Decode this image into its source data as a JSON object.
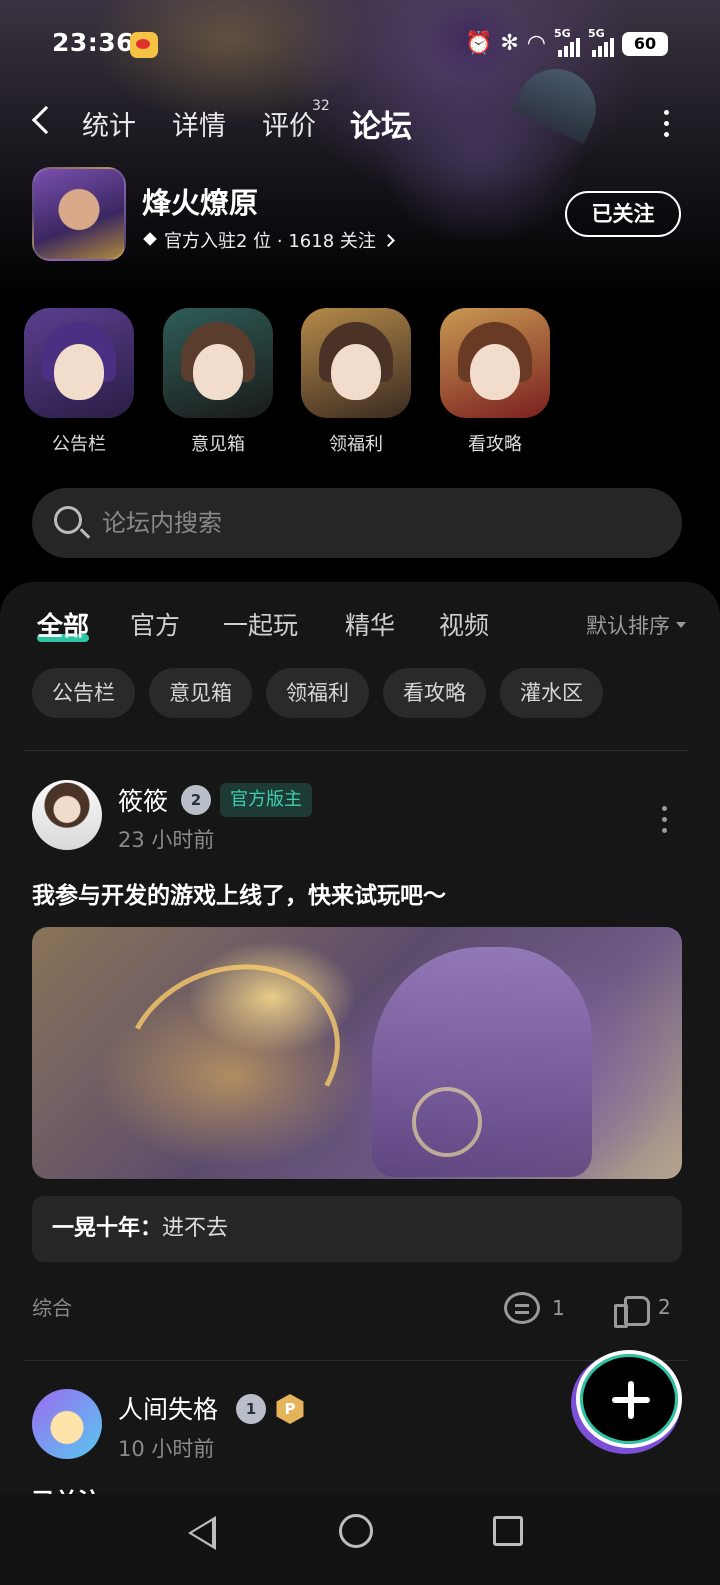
{
  "status_bar": {
    "time": "23:36",
    "battery": "60",
    "net1": "5G",
    "net2": "5G"
  },
  "nav": {
    "tabs": [
      {
        "label": "统计"
      },
      {
        "label": "详情"
      },
      {
        "label": "评价",
        "badge": "32"
      },
      {
        "label": "论坛",
        "active": true
      }
    ]
  },
  "game": {
    "name": "烽火燎原",
    "meta": "官方入驻2 位 · 1618 关注",
    "follow_label": "已关注"
  },
  "quick_entries": [
    {
      "label": "公告栏"
    },
    {
      "label": "意见箱"
    },
    {
      "label": "领福利"
    },
    {
      "label": "看攻略"
    }
  ],
  "search": {
    "placeholder": "论坛内搜索"
  },
  "forum": {
    "tabs": [
      {
        "label": "全部",
        "active": true
      },
      {
        "label": "官方"
      },
      {
        "label": "一起玩"
      },
      {
        "label": "精华"
      },
      {
        "label": "视频"
      }
    ],
    "sort_label": "默认排序",
    "chips": [
      "公告栏",
      "意见箱",
      "领福利",
      "看攻略",
      "灌水区"
    ]
  },
  "posts": [
    {
      "author": "筱筱",
      "level": "2",
      "role": "官方版主",
      "time": "23 小时前",
      "title": "我参与开发的游戏上线了，快来试玩吧～",
      "comment_author": "一晃十年：",
      "comment_text": "进不去",
      "category": "综合",
      "comments": "1",
      "likes": "2"
    },
    {
      "author": "人间失格",
      "level": "1",
      "time": "10 小时前",
      "title_partial": "已关注"
    }
  ],
  "colors": {
    "accent": "#2bc4a4",
    "panel": "#161616",
    "chip": "#2a2a2a"
  }
}
